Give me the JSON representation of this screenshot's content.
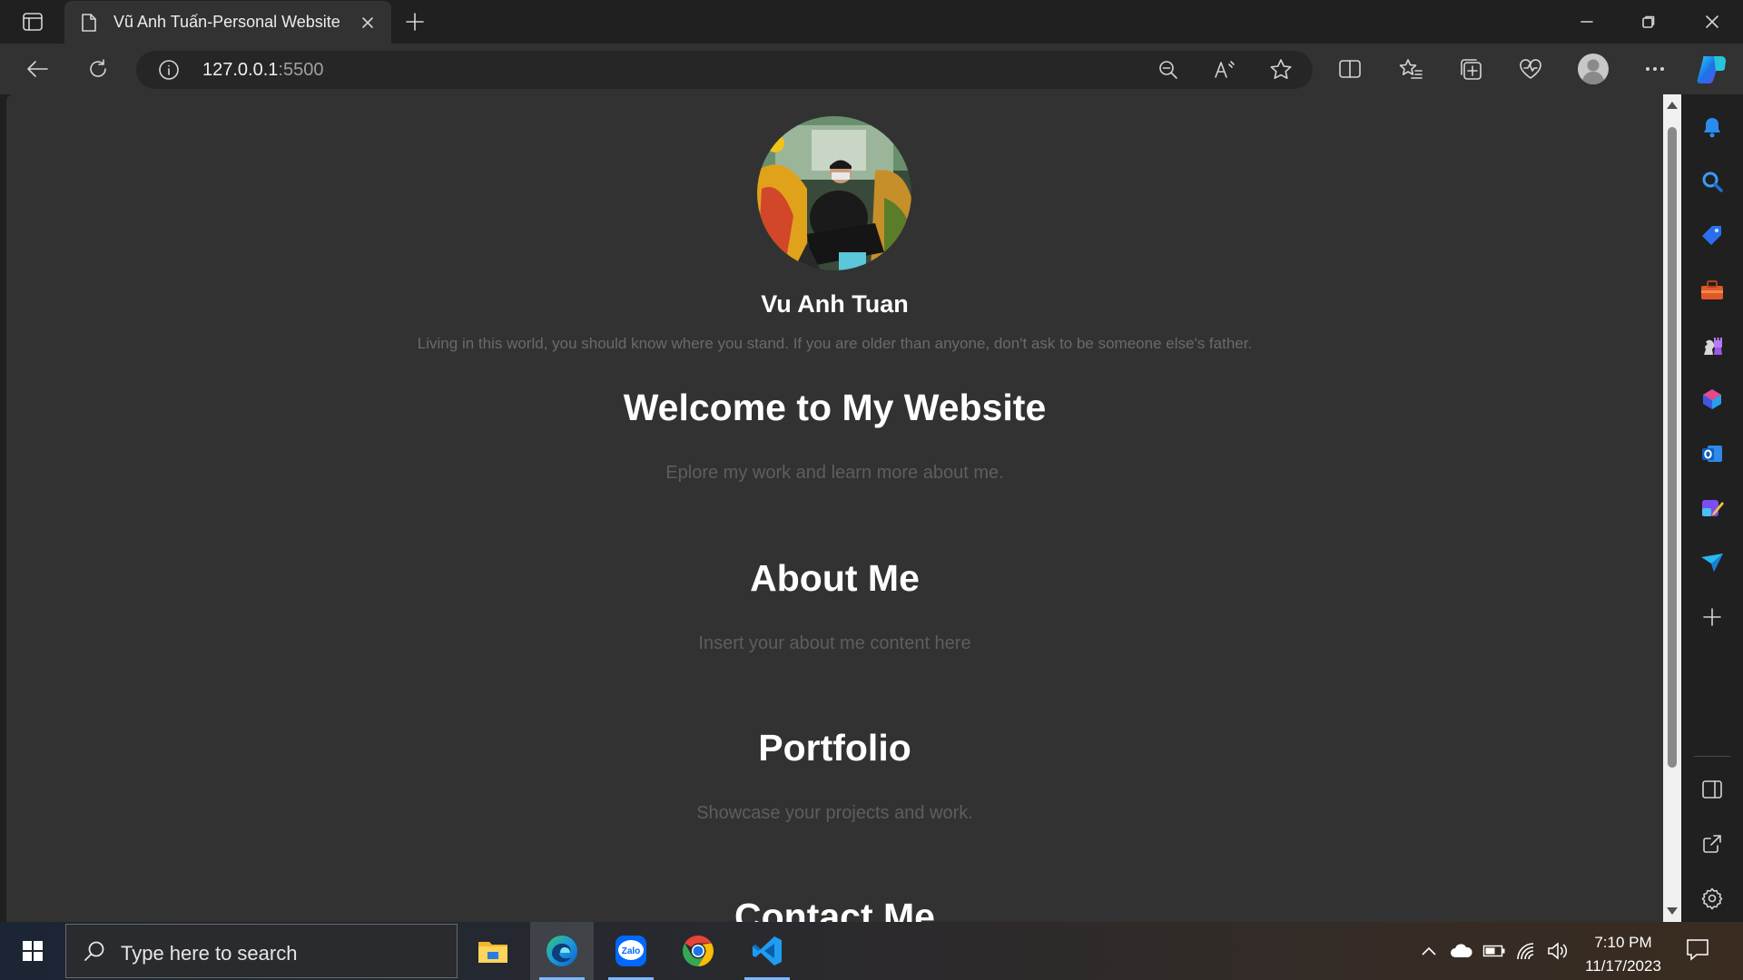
{
  "browser": {
    "tab": {
      "title": "Vũ Anh Tuấn-Personal Website"
    },
    "address": {
      "host": "127.0.0.1",
      "port": ":5500"
    }
  },
  "page": {
    "name": "Vu Anh Tuan",
    "quote": "Living in this world, you should know where you stand. If you are older than anyone, don't ask to be someone else's father.",
    "sections": [
      {
        "heading": "Welcome to My Website",
        "text": "Eplore my work and learn more about me."
      },
      {
        "heading": "About Me",
        "text": "Insert your about me content here"
      },
      {
        "heading": "Portfolio",
        "text": "Showcase your projects and work."
      },
      {
        "heading": "Contact Me",
        "text": ""
      }
    ]
  },
  "taskbar": {
    "search_placeholder": "Type here to search",
    "time": "7:10 PM",
    "date": "11/17/2023",
    "apps": [
      "file-explorer",
      "edge",
      "zalo",
      "chrome",
      "vscode"
    ],
    "zalo_label": "Zalo"
  },
  "colors": {
    "tab_bg": "#202020",
    "toolbar_bg": "#323232",
    "page_bg": "#323232",
    "heading": "#ffffff",
    "muted_text": "#5e5e5e",
    "accent_blue": "#0078d4"
  }
}
